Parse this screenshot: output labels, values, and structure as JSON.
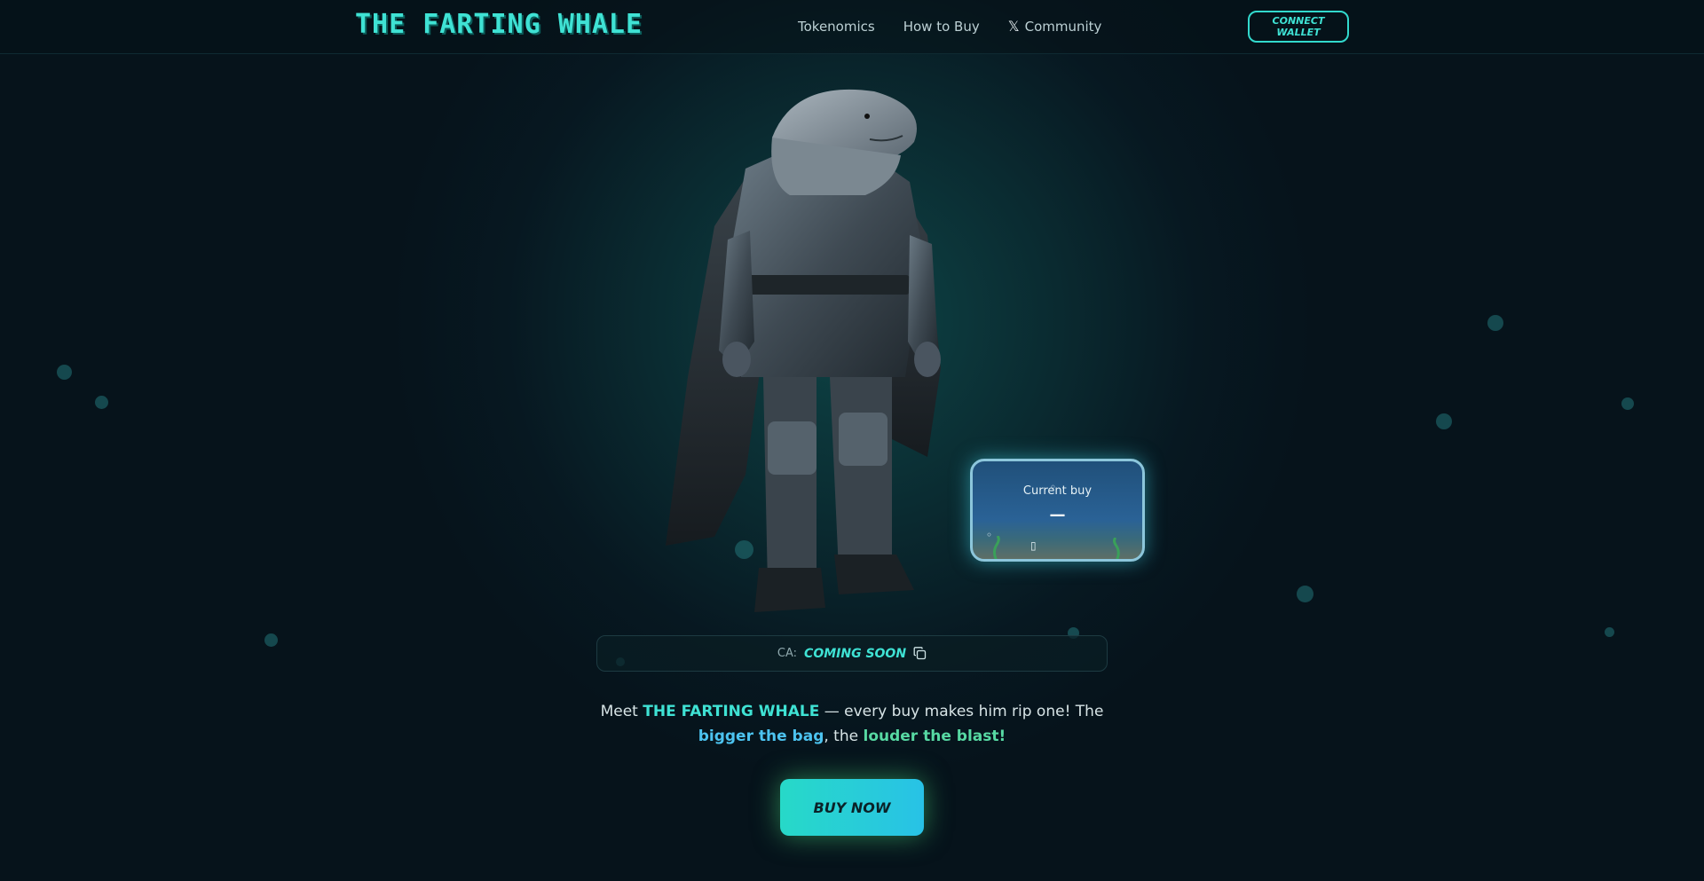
{
  "header": {
    "logo": "THE FARTING WHALE",
    "nav": [
      {
        "label": "Tokenomics"
      },
      {
        "label": "How to Buy"
      },
      {
        "label": "Community",
        "icon": "x-logo-icon"
      }
    ],
    "connect_wallet": "CONNECT WALLET"
  },
  "hero": {
    "image": "armored-whale-character",
    "buy_card": {
      "label": "Current buy",
      "value": "—"
    }
  },
  "contract": {
    "label": "CA:",
    "value": "COMING SOON",
    "icon": "copy-icon"
  },
  "intro": {
    "prefix": "Meet ",
    "name": "THE FARTING WHALE",
    "middle": " — every buy makes him rip one! The ",
    "phrase_1": "bigger the bag",
    "connector": ", the ",
    "phrase_2": "louder the blast!",
    "suffix": " "
  },
  "cta": {
    "buy_now": "BUY NOW"
  },
  "colors": {
    "accent": "#3fe2d4",
    "highlight_blue": "#4cc3f0",
    "highlight_green": "#57d9a3",
    "background": "#06131b"
  }
}
